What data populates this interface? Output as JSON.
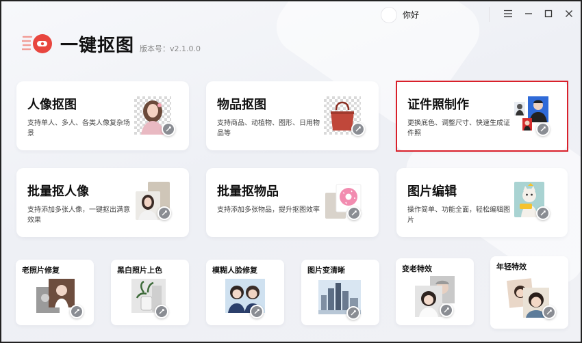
{
  "titlebar": {
    "greeting": "你好"
  },
  "brand": {
    "app_title": "一键抠图",
    "version": "版本号：v2.1.0.0"
  },
  "cards": [
    {
      "title": "人像抠图",
      "desc": "支持单人、多人、各类人像复杂场景"
    },
    {
      "title": "物品抠图",
      "desc": "支持商品、动植物、图形、日用物品等"
    },
    {
      "title": "证件照制作",
      "desc": "更换底色、调整尺寸、快速生成证件照"
    },
    {
      "title": "批量抠人像",
      "desc": "支持添加多张人像，一键抠出满意效果"
    },
    {
      "title": "批量抠物品",
      "desc": "支持添加多张物品，提升抠图效率"
    },
    {
      "title": "图片编辑",
      "desc": "操作简单、功能全面，轻松编辑图片"
    }
  ],
  "tools": [
    {
      "title": "老照片修复"
    },
    {
      "title": "黑白照片上色"
    },
    {
      "title": "模糊人脸修复"
    },
    {
      "title": "图片变清晰"
    },
    {
      "title": "变老特效"
    },
    {
      "title": "年轻特效"
    }
  ],
  "colors": {
    "accent_red": "#e8463f",
    "highlight_border": "#d9202a",
    "badge_gray": "#8a8d93"
  }
}
